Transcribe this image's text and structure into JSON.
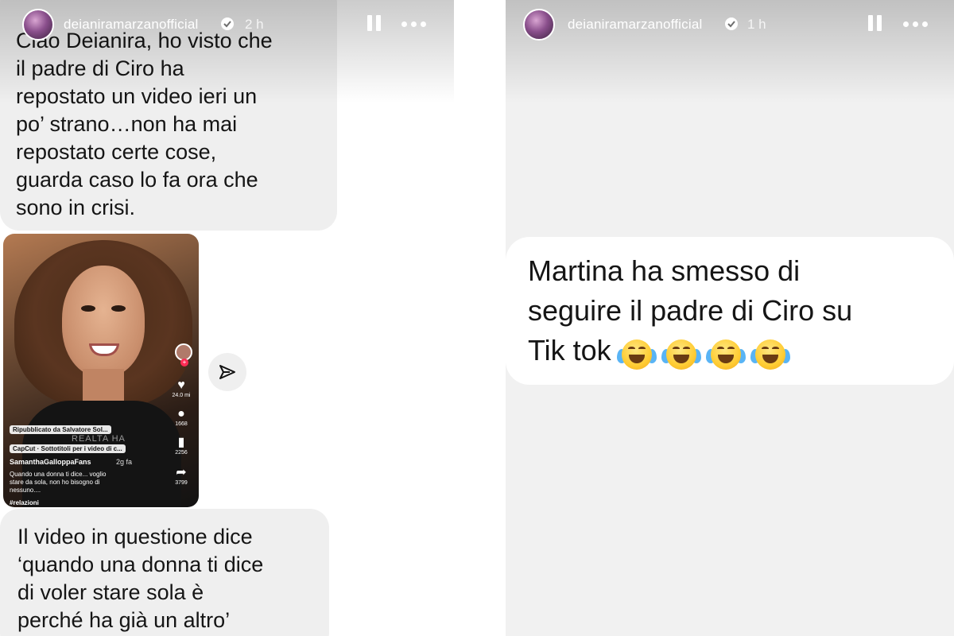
{
  "left_story": {
    "username": "deianiramarzanofficial",
    "time": "2 h",
    "message_top": "Ciao Deianira, ho visto che\nil padre di Ciro ha\nrepostato un video ieri un\npo’ strano…non ha mai\nrepostato certe cose,\nguarda caso lo fa ora che\nsono in crisi.",
    "video": {
      "repost_label": "Ripubblicato da Salvatore Sol...",
      "capcut_label": "CapCut · Sottotitoli per i video di c...",
      "watermark": "REALTA HA",
      "account": "SamanthaGalloppaFans",
      "posted": "2g fa",
      "caption": "Quando una donna ti dice... voglio\nstare da sola, non ho bisogno di\nnessuno....",
      "hashtag": "#relazioni",
      "likes": "24.0 mi",
      "comments": "1668",
      "saves": "2256",
      "shares": "3799"
    },
    "message_bottom": "Il video in questione dice\n‘quando una donna ti dice\ndi voler stare sola è\nperché ha già un altro’"
  },
  "right_story": {
    "username": "deianiramarzanofficial",
    "time": "1 h",
    "message": "Martina ha smesso di\nseguire il padre di Ciro su\nTik tok",
    "emoji": [
      "face-with-tears-of-joy",
      "face-with-tears-of-joy",
      "face-with-tears-of-joy",
      "face-with-tears-of-joy"
    ]
  }
}
